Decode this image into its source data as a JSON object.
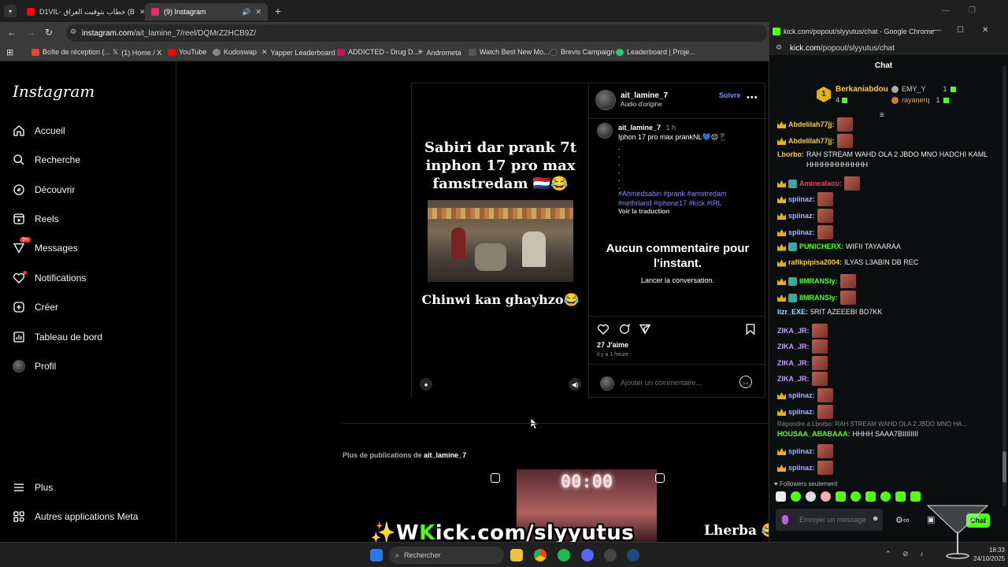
{
  "browser": {
    "tabs": [
      {
        "title": "D1VIL- خطاب بتوقيت العراق (B",
        "favicon_color": "#ff0000"
      },
      {
        "title": "(9) Instagram",
        "favicon_color": "#e1306c"
      }
    ],
    "url_domain": "instagram.com",
    "url_path": "/ait_lamine_7/reel/DQMrZ2HCB9Z/",
    "bookmarks": [
      {
        "label": "Boîte de réception (...",
        "color": "#ea4335"
      },
      {
        "label": "(1) Home / X",
        "color": "#ffffff"
      },
      {
        "label": "YouTube",
        "color": "#ff0000"
      },
      {
        "label": "Kudoswap",
        "color": "#888888"
      },
      {
        "label": "Yapper Leaderboard",
        "color": "#cccccc"
      },
      {
        "label": "ADDICTED - Drug D...",
        "color": "#c2185b"
      },
      {
        "label": "Andrometa",
        "color": "#dddddd"
      },
      {
        "label": "Watch Best New Mo...",
        "color": "#aaaaaa"
      },
      {
        "label": "Brevis Campaign",
        "color": "#333333"
      },
      {
        "label": "Leaderboard | Proje...",
        "color": "#2ecc71"
      }
    ]
  },
  "instagram": {
    "logo": "Instagram",
    "nav": [
      {
        "label": "Accueil",
        "icon": "home-icon"
      },
      {
        "label": "Recherche",
        "icon": "search-icon"
      },
      {
        "label": "Découvrir",
        "icon": "compass-icon"
      },
      {
        "label": "Reels",
        "icon": "reels-icon"
      },
      {
        "label": "Messages",
        "icon": "messenger-icon",
        "badge": "9+"
      },
      {
        "label": "Notifications",
        "icon": "heart-icon"
      },
      {
        "label": "Créer",
        "icon": "plus-icon"
      },
      {
        "label": "Tableau de bord",
        "icon": "dashboard-icon"
      },
      {
        "label": "Profil",
        "icon": "avatar-icon"
      }
    ],
    "more": "Plus",
    "meta_apps": "Autres applications Meta",
    "post": {
      "username": "ait_lamine_7",
      "audio": "Audio d'origine",
      "follow": "Suivre",
      "caption_user": "ait_lamine_7",
      "caption_time": "1 h",
      "caption_text": "Iphon 17 pro max prankNL💙😌📱",
      "hashtags": "#Ahmedsabiri #prank #amstredam #nethrland #iphone17 #kick #IRL",
      "translate": "Voir la traduction",
      "no_comments_title": "Aucun commentaire pour l'instant.",
      "no_comments_sub": "Lancer la conversation.",
      "likes": "27 J'aime",
      "posted": "il y a 1 heure",
      "comment_placeholder": "Ajouter un commentaire...",
      "media_title": "Sabiri dar prank 7t inphon 17 pro max famstredam 🇳🇱😂",
      "media_sub": "Chinwi kan ghayhzo😂"
    },
    "more_posts_prefix": "Plus de publications de",
    "more_posts_user": "ait_lamine_7",
    "thumb_timer": "00:00",
    "thumb_right_text": "Lherba 😂"
  },
  "kick": {
    "window_title": "kick.com/popout/slyyutus/chat - Google Chrome",
    "url_domain": "kick.com",
    "url_path": "/popout/slyyutus/chat",
    "chat_header": "Chat",
    "top_gifters": [
      {
        "rank": "1",
        "name": "Berkaniabdou",
        "count": "4"
      },
      {
        "name": "EMY_Y",
        "count": "1"
      },
      {
        "name": "rayanerq",
        "count": "1"
      }
    ],
    "messages": [
      {
        "user": "Abdelilah77jj:",
        "color": "#f7c948",
        "text": "",
        "emote": true,
        "badge": "crown"
      },
      {
        "user": "Abdelilah77jj:",
        "color": "#f7c948",
        "text": "",
        "emote": true,
        "badge": "crown"
      },
      {
        "user": "Lborbo:",
        "color": "#f7c948",
        "text": "RAH STREAM WAHD OLA 2 JBDO MNO HADCHI KAML HHHHHHHHHHHH",
        "emote": false,
        "badge": "none"
      },
      {
        "user": "Aminealaou:",
        "color": "#e0446f",
        "text": "",
        "emote": true,
        "badge": "crown"
      },
      {
        "user": "spiinaz:",
        "color": "#a7b6ff",
        "text": "",
        "emote": true,
        "badge": "crown"
      },
      {
        "user": "spiinaz:",
        "color": "#a7b6ff",
        "text": "",
        "emote": true,
        "badge": "crown"
      },
      {
        "user": "spiinaz:",
        "color": "#a7b6ff",
        "text": "",
        "emote": true,
        "badge": "crown"
      },
      {
        "user": "PUNICHERX:",
        "color": "#53fc18",
        "text": "WIFII TAYAARAA",
        "emote": false,
        "badge": "crown"
      },
      {
        "user": "rafikpipisa2004:",
        "color": "#f7c948",
        "text": "ILYAS L3ABIN DB REC",
        "emote": false,
        "badge": "crown"
      },
      {
        "user": "IIMRANSly:",
        "color": "#53fc18",
        "text": "",
        "emote": true,
        "badge": "crown"
      },
      {
        "user": "IIMRANSly:",
        "color": "#53fc18",
        "text": "",
        "emote": true,
        "badge": "crown"
      },
      {
        "user": "lizr_EXE:",
        "color": "#8be8ff",
        "text": "5RIT AZEEEBI BD7KK",
        "emote": false,
        "badge": "none"
      },
      {
        "user": "ZIKA_JR:",
        "color": "#c89bff",
        "text": "",
        "emote": true,
        "badge": "none"
      },
      {
        "user": "ZIKA_JR:",
        "color": "#c89bff",
        "text": "",
        "emote": true,
        "badge": "none"
      },
      {
        "user": "ZIKA_JR:",
        "color": "#c89bff",
        "text": "",
        "emote": true,
        "badge": "none"
      },
      {
        "user": "ZIKA_JR:",
        "color": "#c89bff",
        "text": "",
        "emote": true,
        "badge": "none"
      },
      {
        "user": "spiinaz:",
        "color": "#a7b6ff",
        "text": "",
        "emote": true,
        "badge": "crown"
      },
      {
        "user": "spiinaz:",
        "color": "#a7b6ff",
        "text": "",
        "emote": true,
        "badge": "crown"
      }
    ],
    "reply_context": "Répondre à Lborbo: RAH STREAM WAHD OLA 2 JBDO MNO HA...",
    "reply_msg": {
      "user": "HOUSAA_ABABAAA:",
      "color": "#53fc18",
      "text": "HHHH SAAA7BIIIIIIII"
    },
    "after_messages": [
      {
        "user": "spiinaz:",
        "color": "#a7b6ff"
      },
      {
        "user": "spiinaz:",
        "color": "#a7b6ff"
      }
    ],
    "followers_only": "Followers seulement",
    "input_placeholder": "Envoyer un message",
    "send_label": "Chat",
    "accent": "#53fc18"
  },
  "stream_overlay": {
    "prefix": "✨W",
    "brand": "K",
    "suffix": "ick.com/slyyutus"
  },
  "taskbar": {
    "search_placeholder": "Rechercher",
    "time": "18:33",
    "date": "24/10/2025"
  }
}
